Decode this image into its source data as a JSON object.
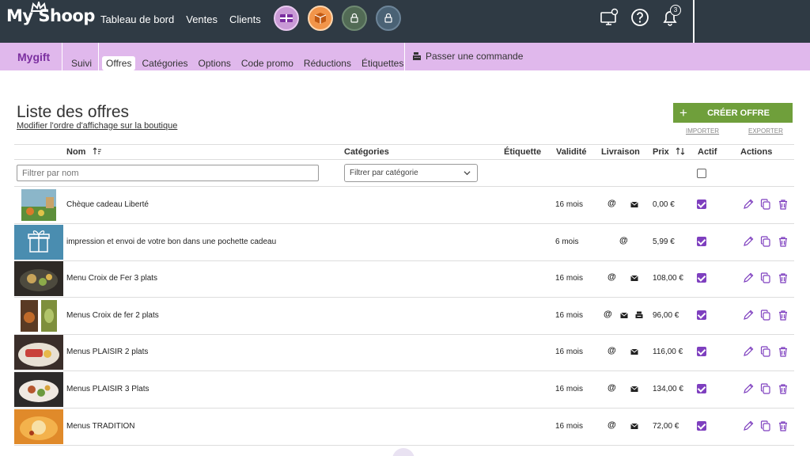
{
  "app": {
    "logo": "My Shoop"
  },
  "topnav": {
    "items": [
      "Tableau de bord",
      "Ventes",
      "Clients"
    ]
  },
  "notifications": {
    "count": "3"
  },
  "subnav": {
    "brand": "Mygift",
    "items": [
      "Suivi",
      "Offres",
      "Catégories",
      "Options",
      "Code promo",
      "Réductions",
      "Étiquettes"
    ],
    "active": "Offres",
    "order_label": "Passer une commande"
  },
  "page": {
    "title": "Liste des offres",
    "reorder_link": "Modifier l'ordre d'affichage sur la boutique",
    "create_button": "CRÉER OFFRE",
    "import_link": "IMPORTER",
    "export_link": "EXPORTER"
  },
  "table": {
    "columns": {
      "name": "Nom",
      "categories": "Catégories",
      "label": "Étiquette",
      "validity": "Validité",
      "delivery": "Livraison",
      "price": "Prix",
      "active": "Actif",
      "actions": "Actions"
    },
    "filters": {
      "name_placeholder": "Filtrer par nom",
      "category_placeholder": "Filtrer par catégorie"
    },
    "rows": [
      {
        "name": "Chèque cadeau Liberté",
        "validity": "16 mois",
        "delivery": [
          "email",
          "post"
        ],
        "price": "0,00 €",
        "active": true
      },
      {
        "name": "impression et envoi de votre bon dans une pochette cadeau",
        "validity": "6 mois",
        "delivery": [
          "email"
        ],
        "price": "5,99 €",
        "active": true
      },
      {
        "name": "Menu Croix de Fer 3 plats",
        "validity": "16 mois",
        "delivery": [
          "email",
          "post"
        ],
        "price": "108,00 €",
        "active": true
      },
      {
        "name": "Menus Croix de fer 2 plats",
        "validity": "16 mois",
        "delivery": [
          "email",
          "post",
          "print"
        ],
        "price": "96,00 €",
        "active": true
      },
      {
        "name": "Menus PLAISIR 2 plats",
        "validity": "16 mois",
        "delivery": [
          "email",
          "post"
        ],
        "price": "116,00 €",
        "active": true
      },
      {
        "name": "Menus PLAISIR 3 Plats",
        "validity": "16 mois",
        "delivery": [
          "email",
          "post"
        ],
        "price": "134,00 €",
        "active": true
      },
      {
        "name": "Menus TRADITION",
        "validity": "16 mois",
        "delivery": [
          "email",
          "post"
        ],
        "price": "72,00 €",
        "active": true
      }
    ]
  },
  "colors": {
    "topbar": "#2f3a44",
    "subnav": "#e0b8ec",
    "accent": "#7e3fbf",
    "create": "#6f9f3b"
  }
}
